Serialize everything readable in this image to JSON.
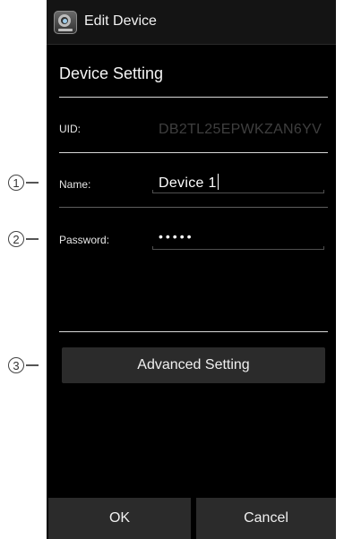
{
  "header": {
    "title": "Edit Device",
    "icon": "camera-app-icon"
  },
  "section_title": "Device Setting",
  "fields": {
    "uid": {
      "label": "UID:",
      "value": "DB2TL25EPWKZAN6YV"
    },
    "name": {
      "label": "Name:",
      "value": "Device 1"
    },
    "password": {
      "label": "Password:",
      "value": "•••••"
    }
  },
  "advanced_button": "Advanced Setting",
  "footer": {
    "ok": "OK",
    "cancel": "Cancel"
  },
  "callouts": {
    "one": "1",
    "two": "2",
    "three": "3"
  },
  "colors": {
    "background": "#000000",
    "button": "#2b2b2b",
    "divider": "#d8d8d8",
    "uid_text": "#3f3f3f"
  }
}
